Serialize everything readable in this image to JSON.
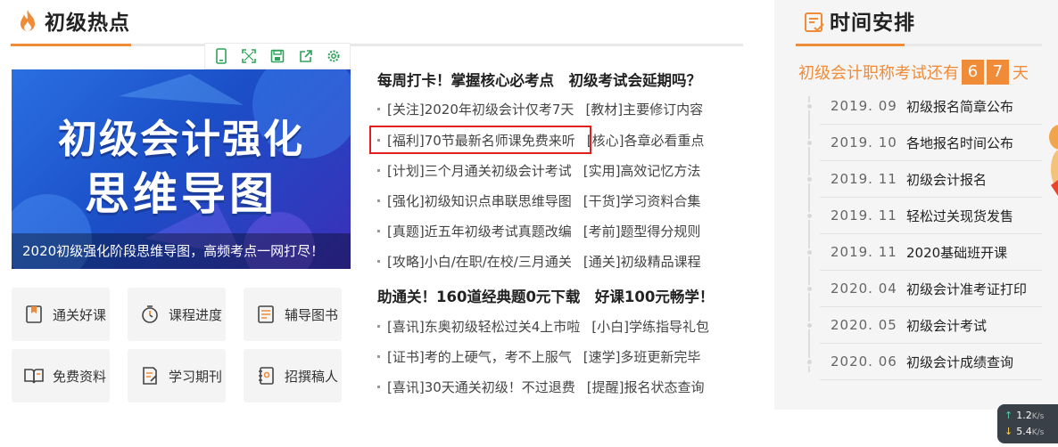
{
  "hot": {
    "title": "初级热点",
    "banner": {
      "line1": "初级会计强化",
      "line2": "思维导图",
      "caption": "2020初级强化阶段思维导图，高频考点一网打尽！"
    },
    "toolbar_icons": [
      "tablet-icon",
      "fullscreen-icon",
      "save-icon",
      "share-icon",
      "settings-icon"
    ],
    "quick_links": [
      {
        "label": "通关好课",
        "icon": "bookmark-icon"
      },
      {
        "label": "课程进度",
        "icon": "timer-icon"
      },
      {
        "label": "辅导图书",
        "icon": "checklist-icon"
      },
      {
        "label": "免费资料",
        "icon": "open-book-icon"
      },
      {
        "label": "学习期刊",
        "icon": "document-edit-icon"
      },
      {
        "label": "招撰稿人",
        "icon": "notebook-icon"
      }
    ],
    "news_head_1": "每周打卡！掌握核心必考点　初级考试会延期吗？",
    "news_group_1": [
      {
        "left": "[关注]2020年初级会计仅考7天",
        "right": "[教材]主要修订内容"
      },
      {
        "left": "[福利]70节最新名师课免费来听",
        "right": "[核心]各章必看重点"
      },
      {
        "left": "[计划]三个月通关初级会计考试",
        "right": "[实用]高效记忆方法"
      },
      {
        "left": "[强化]初级知识点串联思维导图",
        "right": "[干货]学习资料合集"
      },
      {
        "left": "[真题]近五年初级考试真题改编",
        "right": "[考前]题型得分规则"
      },
      {
        "left": "[攻略]小白/在职/在校/三月通关",
        "right": "[通关]初级精品课程"
      }
    ],
    "news_head_2": "助通关！160道经典题0元下载　好课100元畅学！",
    "news_group_2": [
      {
        "left": "[喜讯]东奥初级轻松过关4上市啦",
        "right": "[小白]学练指导礼包"
      },
      {
        "left": "[证书]考的上硬气，考不上服气",
        "right": "[速学]多班更新完毕"
      },
      {
        "left": "[喜讯]30天通关初级！不过退费",
        "right": "[提醒]报名状态查询"
      }
    ]
  },
  "schedule": {
    "title": "时间安排",
    "countdown_prefix": "初级会计职称考试还有",
    "countdown_digits": [
      "6",
      "7"
    ],
    "countdown_suffix": "天",
    "items": [
      {
        "date": "2019. 09",
        "event": "初级报名简章公布"
      },
      {
        "date": "2019. 10",
        "event": "各地报名时间公布"
      },
      {
        "date": "2019. 11",
        "event": "初级会计报名"
      },
      {
        "date": "2019. 11",
        "event": "轻松过关现货发售"
      },
      {
        "date": "2019. 11",
        "event": "2020基础班开课"
      },
      {
        "date": "2020. 04",
        "event": "初级会计准考证打印"
      },
      {
        "date": "2020. 05",
        "event": "初级会计考试"
      },
      {
        "date": "2020. 06",
        "event": "初级会计成绩查询"
      }
    ]
  },
  "net_speed": {
    "up": "1.2",
    "down": "5.4",
    "unit": "K/s"
  },
  "colors": {
    "accent": "#f08c38",
    "highlight_border": "#e02020",
    "panel_bg": "#f5f5f5",
    "tile_bg": "#f4f4f4"
  }
}
